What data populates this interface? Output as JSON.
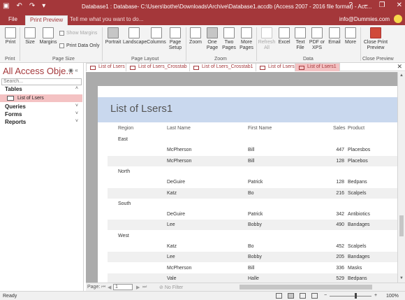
{
  "window": {
    "title": "Database1 : Database- C:\\Users\\bothe\\Downloads\\Archive\\Database1.accdb (Access 2007 - 2016 file format) - Acc...",
    "qat": [
      "save-icon",
      "undo-icon",
      "redo-icon",
      "customize-icon"
    ],
    "controls": [
      "?",
      "–",
      "❐",
      "✕"
    ]
  },
  "tabs": {
    "file": "File",
    "print_preview": "Print Preview",
    "tell_me": "Tell me what you want to do...",
    "user": "info@Dummies.com"
  },
  "ribbon": {
    "print": "Print",
    "size": "Size",
    "margins": "Margins",
    "show_margins": "Show Margins",
    "print_data_only": "Print Data Only",
    "portrait": "Portrait",
    "landscape": "Landscape",
    "columns": "Columns",
    "page_setup": "Page Setup",
    "zoom": "Zoom",
    "one_page": "One Page",
    "two_pages": "Two Pages",
    "more_pages": "More Pages",
    "refresh_all": "Refresh All",
    "excel": "Excel",
    "text_file": "Text File",
    "pdf_xps": "PDF or XPS",
    "email": "Email",
    "more": "More",
    "close_print_preview": "Close Print Preview",
    "groups": {
      "print": "Print",
      "page_size": "Page Size",
      "page_layout": "Page Layout",
      "zoom": "Zoom",
      "data": "Data",
      "close_preview": "Close Preview"
    }
  },
  "nav": {
    "header": "All Access Obje...",
    "search_placeholder": "Search...",
    "sections": [
      "Tables",
      "Queries",
      "Forms",
      "Reports"
    ],
    "table_item": "List of Lsers"
  },
  "doc_tabs": [
    "List of Lsers",
    "List of Lsers_Crosstab",
    "List of Lsers_Crosstab1",
    "List of Lsers",
    "List of Lsers1"
  ],
  "report": {
    "title": "List of Lsers1",
    "headers": [
      "Region",
      "Last Name",
      "First Name",
      "Sales",
      "Product"
    ],
    "rows": [
      {
        "region": "East"
      },
      {
        "last": "McPherson",
        "first": "Bill",
        "sales": "447",
        "product": "Placesbos"
      },
      {
        "last": "McPherson",
        "first": "Bill",
        "sales": "128",
        "product": "Placebos"
      },
      {
        "region": "North"
      },
      {
        "last": "DeGuire",
        "first": "Patrick",
        "sales": "128",
        "product": "Bedpans"
      },
      {
        "last": "Katz",
        "first": "Bo",
        "sales": "216",
        "product": "Scalpels"
      },
      {
        "region": "South"
      },
      {
        "last": "DeGuire",
        "first": "Patrick",
        "sales": "342",
        "product": "Antibiotics"
      },
      {
        "last": "Lee",
        "first": "Bobby",
        "sales": "490",
        "product": "Bandages"
      },
      {
        "region": "West"
      },
      {
        "last": "Katz",
        "first": "Bo",
        "sales": "452",
        "product": "Scalpels"
      },
      {
        "last": "Lee",
        "first": "Bobby",
        "sales": "205",
        "product": "Bandages"
      },
      {
        "last": "McPherson",
        "first": "Bill",
        "sales": "336",
        "product": "Masks"
      },
      {
        "last": "Vale",
        "first": "Halle",
        "sales": "529",
        "product": "Bedpans"
      }
    ]
  },
  "record_nav": {
    "page_label": "Page:",
    "page_value": "1",
    "no_filter": "No Filter"
  },
  "status": {
    "ready": "Ready",
    "zoom": "100%"
  },
  "colors": {
    "access_red": "#a4373a",
    "title_band": "#c9d8ee",
    "selected_pink": "#f4c2c3"
  }
}
